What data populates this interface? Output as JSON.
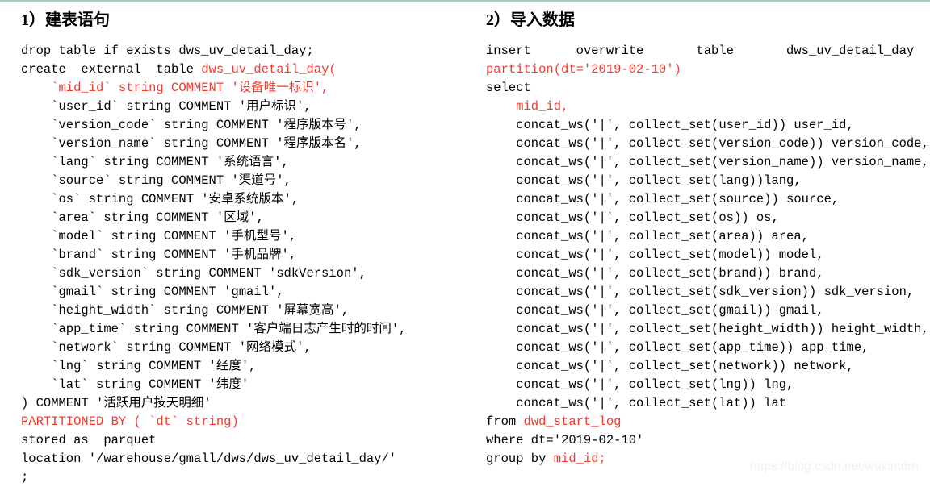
{
  "meta": {
    "top_rule_color": "#9ecdcb",
    "keyword_red": "#f5392c",
    "body_black": "#000000",
    "background": "#ffffff"
  },
  "watermark": {
    "text": "https://blog.csdn.net/wuxintdrh"
  },
  "left": {
    "heading": "1）建表语句",
    "lines": [
      {
        "id": "l01",
        "segments": [
          {
            "text": "drop table if exists dws_uv_detail_day;",
            "color": "black"
          }
        ]
      },
      {
        "id": "l02",
        "segments": [
          {
            "text": "create  external  table ",
            "color": "black"
          },
          {
            "text": "dws_uv_detail_day(",
            "color": "red"
          }
        ]
      },
      {
        "id": "l03",
        "segments": [
          {
            "text": "    `mid_id` string COMMENT '设备唯一标识',",
            "color": "red"
          }
        ]
      },
      {
        "id": "l04",
        "segments": [
          {
            "text": "    `user_id` string COMMENT '用户标识',",
            "color": "black"
          }
        ]
      },
      {
        "id": "l05",
        "segments": [
          {
            "text": "    `version_code` string COMMENT '程序版本号',",
            "color": "black"
          }
        ]
      },
      {
        "id": "l06",
        "segments": [
          {
            "text": "    `version_name` string COMMENT '程序版本名',",
            "color": "black"
          }
        ]
      },
      {
        "id": "l07",
        "segments": [
          {
            "text": "    `lang` string COMMENT '系统语言',",
            "color": "black"
          }
        ]
      },
      {
        "id": "l08",
        "segments": [
          {
            "text": "    `source` string COMMENT '渠道号',",
            "color": "black"
          }
        ]
      },
      {
        "id": "l09",
        "segments": [
          {
            "text": "    `os` string COMMENT '安卓系统版本',",
            "color": "black"
          }
        ]
      },
      {
        "id": "l10",
        "segments": [
          {
            "text": "    `area` string COMMENT '区域',",
            "color": "black"
          }
        ]
      },
      {
        "id": "l11",
        "segments": [
          {
            "text": "    `model` string COMMENT '手机型号',",
            "color": "black"
          }
        ]
      },
      {
        "id": "l12",
        "segments": [
          {
            "text": "    `brand` string COMMENT '手机品牌',",
            "color": "black"
          }
        ]
      },
      {
        "id": "l13",
        "segments": [
          {
            "text": "    `sdk_version` string COMMENT 'sdkVersion',",
            "color": "black"
          }
        ]
      },
      {
        "id": "l14",
        "segments": [
          {
            "text": "    `gmail` string COMMENT 'gmail',",
            "color": "black"
          }
        ]
      },
      {
        "id": "l15",
        "segments": [
          {
            "text": "    `height_width` string COMMENT '屏幕宽高',",
            "color": "black"
          }
        ]
      },
      {
        "id": "l16",
        "segments": [
          {
            "text": "    `app_time` string COMMENT '客户端日志产生时的时间',",
            "color": "black"
          }
        ]
      },
      {
        "id": "l17",
        "segments": [
          {
            "text": "    `network` string COMMENT '网络模式',",
            "color": "black"
          }
        ]
      },
      {
        "id": "l18",
        "segments": [
          {
            "text": "    `lng` string COMMENT '经度',",
            "color": "black"
          }
        ]
      },
      {
        "id": "l19",
        "segments": [
          {
            "text": "    `lat` string COMMENT '纬度'",
            "color": "black"
          }
        ]
      },
      {
        "id": "l20",
        "segments": [
          {
            "text": ") COMMENT '活跃用户按天明细'",
            "color": "black"
          }
        ]
      },
      {
        "id": "l21",
        "segments": [
          {
            "text": "PARTITIONED BY ( `dt` string)",
            "color": "red"
          }
        ]
      },
      {
        "id": "l22",
        "segments": [
          {
            "text": "stored as  parquet",
            "color": "black"
          }
        ]
      },
      {
        "id": "l23",
        "segments": [
          {
            "text": "location '/warehouse/gmall/dws/dws_uv_detail_day/'",
            "color": "black"
          }
        ]
      },
      {
        "id": "l24",
        "segments": [
          {
            "text": ";",
            "color": "black"
          }
        ]
      }
    ]
  },
  "right": {
    "heading": "2）导入数据",
    "lines": [
      {
        "id": "r01",
        "segments": [
          {
            "text": "insert      overwrite       table       dws_uv_detail_day",
            "color": "black"
          }
        ]
      },
      {
        "id": "r02",
        "segments": [
          {
            "text": "partition(dt='2019-02-10')",
            "color": "red"
          }
        ]
      },
      {
        "id": "r03",
        "segments": [
          {
            "text": "select",
            "color": "black"
          }
        ]
      },
      {
        "id": "r04",
        "segments": [
          {
            "text": "    mid_id,",
            "color": "red"
          }
        ]
      },
      {
        "id": "r05",
        "segments": [
          {
            "text": "    concat_ws('|', collect_set(user_id)) user_id,",
            "color": "black"
          }
        ]
      },
      {
        "id": "r06",
        "segments": [
          {
            "text": "    concat_ws('|', collect_set(version_code)) version_code,",
            "color": "black"
          }
        ]
      },
      {
        "id": "r07",
        "segments": [
          {
            "text": "    concat_ws('|', collect_set(version_name)) version_name,",
            "color": "black"
          }
        ]
      },
      {
        "id": "r08",
        "segments": [
          {
            "text": "    concat_ws('|', collect_set(lang))lang,",
            "color": "black"
          }
        ]
      },
      {
        "id": "r09",
        "segments": [
          {
            "text": "    concat_ws('|', collect_set(source)) source,",
            "color": "black"
          }
        ]
      },
      {
        "id": "r10",
        "segments": [
          {
            "text": "    concat_ws('|', collect_set(os)) os,",
            "color": "black"
          }
        ]
      },
      {
        "id": "r11",
        "segments": [
          {
            "text": "    concat_ws('|', collect_set(area)) area,",
            "color": "black"
          }
        ]
      },
      {
        "id": "r12",
        "segments": [
          {
            "text": "    concat_ws('|', collect_set(model)) model,",
            "color": "black"
          }
        ]
      },
      {
        "id": "r13",
        "segments": [
          {
            "text": "    concat_ws('|', collect_set(brand)) brand,",
            "color": "black"
          }
        ]
      },
      {
        "id": "r14",
        "segments": [
          {
            "text": "    concat_ws('|', collect_set(sdk_version)) sdk_version,",
            "color": "black"
          }
        ]
      },
      {
        "id": "r15",
        "segments": [
          {
            "text": "    concat_ws('|', collect_set(gmail)) gmail,",
            "color": "black"
          }
        ]
      },
      {
        "id": "r16",
        "segments": [
          {
            "text": "    concat_ws('|', collect_set(height_width)) height_width,",
            "color": "black"
          }
        ]
      },
      {
        "id": "r17",
        "segments": [
          {
            "text": "    concat_ws('|', collect_set(app_time)) app_time,",
            "color": "black"
          }
        ]
      },
      {
        "id": "r18",
        "segments": [
          {
            "text": "    concat_ws('|', collect_set(network)) network,",
            "color": "black"
          }
        ]
      },
      {
        "id": "r19",
        "segments": [
          {
            "text": "    concat_ws('|', collect_set(lng)) lng,",
            "color": "black"
          }
        ]
      },
      {
        "id": "r20",
        "segments": [
          {
            "text": "    concat_ws('|', collect_set(lat)) lat",
            "color": "black"
          }
        ]
      },
      {
        "id": "r21",
        "segments": [
          {
            "text": "from ",
            "color": "black"
          },
          {
            "text": "dwd_start_log",
            "color": "red"
          }
        ]
      },
      {
        "id": "r22",
        "segments": [
          {
            "text": "where dt='2019-02-10'",
            "color": "black"
          }
        ]
      },
      {
        "id": "r23",
        "segments": [
          {
            "text": "group by ",
            "color": "black"
          },
          {
            "text": "mid_id;",
            "color": "red"
          }
        ]
      }
    ]
  }
}
